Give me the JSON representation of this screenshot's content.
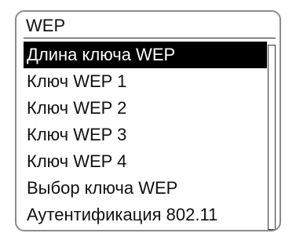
{
  "menu": {
    "title": "WEP",
    "items": [
      {
        "label": "Длина ключа WEP",
        "selected": true
      },
      {
        "label": "Ключ WEP 1",
        "selected": false
      },
      {
        "label": "Ключ WEP 2",
        "selected": false
      },
      {
        "label": "Ключ WEP 3",
        "selected": false
      },
      {
        "label": "Ключ WEP 4",
        "selected": false
      },
      {
        "label": "Выбор ключа WEP",
        "selected": false
      },
      {
        "label": "Аутентификация 802.11",
        "selected": false
      }
    ]
  },
  "colors": {
    "selected_bg": "#000000",
    "selected_text": "#ffffff",
    "text": "#111111",
    "border": "#8c8c8c"
  }
}
